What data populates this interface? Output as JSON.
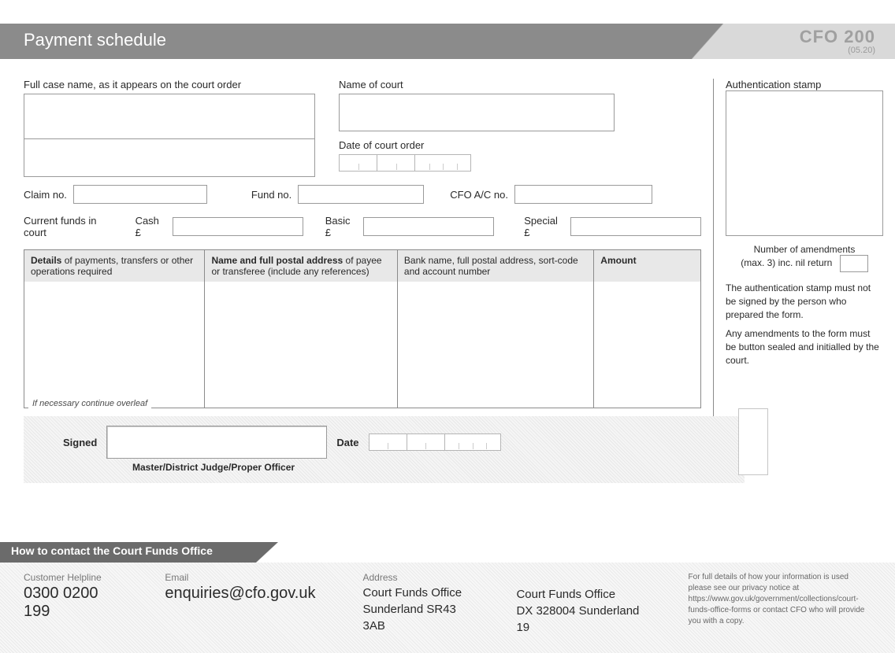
{
  "header": {
    "title": "Payment schedule",
    "code": "CFO 200",
    "date": "(05.20)"
  },
  "labels": {
    "caseName": "Full case name, as it appears on the court order",
    "court": "Name of court",
    "dateOrder": "Date of court order",
    "claimNo": "Claim no.",
    "fundNo": "Fund no.",
    "cfoAcNo": "CFO A/C no.",
    "currentFunds": "Current funds in court",
    "cash": "Cash  £",
    "basic": "Basic  £",
    "special": "Special  £",
    "overleaf": "If necessary continue overleaf",
    "signed": "Signed",
    "date": "Date",
    "signerRole": "Master/District Judge/Proper Officer",
    "auth": "Authentication stamp",
    "amend1": "Number of amendments",
    "amend2": "(max. 3) inc. nil return",
    "note1": "The authentication stamp must not be signed by the person who prepared the form.",
    "note2": "Any amendments to the form must be button sealed and initialled by the court."
  },
  "columns": {
    "c1b": "Details",
    "c1": " of payments, transfers or other operations required",
    "c2b": "Name and full postal address",
    "c2": " of payee or transferee (include any references)",
    "c3": "Bank name, full postal address, sort-code and account number",
    "c4": "Amount"
  },
  "footer": {
    "contactHead": "How to contact the Court Funds Office",
    "helpLbl": "Customer Helpline",
    "helpVal": "0300 0200 199",
    "emailLbl": "Email",
    "emailVal": "enquiries@cfo.gov.uk",
    "addrLbl": "Address",
    "addr1a": "Court Funds Office",
    "addr1b": "Sunderland  SR43 3AB",
    "addr2a": "Court Funds Office",
    "addr2b": "DX 328004   Sunderland 19",
    "privacy": "For full details of how your information is used please see our privacy notice at https://www.gov.uk/government/collections/court-funds-office-forms or contact CFO who will provide you with a copy."
  }
}
